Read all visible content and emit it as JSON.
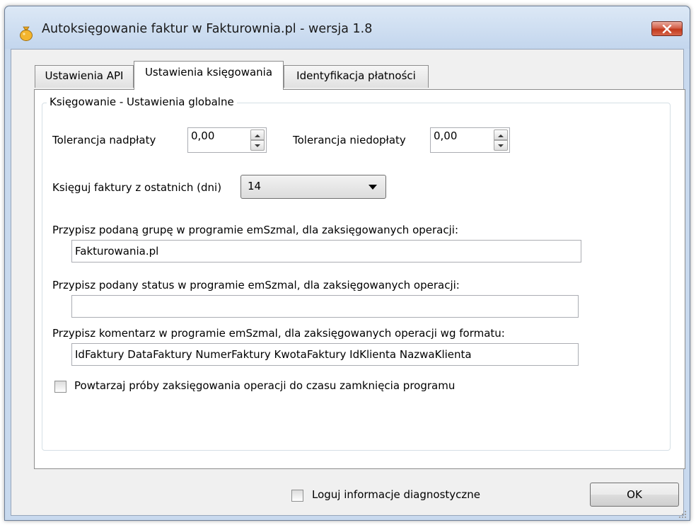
{
  "window": {
    "title": "Autoksięgowanie faktur w Fakturownia.pl - wersja 1.8"
  },
  "tabs": [
    {
      "label": "Ustawienia API",
      "active": false
    },
    {
      "label": "Ustawienia księgowania",
      "active": true
    },
    {
      "label": "Identyfikacja płatności",
      "active": false
    }
  ],
  "group": {
    "legend": "Księgowanie - Ustawienia globalne"
  },
  "overpay": {
    "label": "Tolerancja nadpłaty",
    "value": "0,00"
  },
  "underpay": {
    "label": "Tolerancja niedopłaty",
    "value": "0,00"
  },
  "days": {
    "label": "Księguj faktury z ostatnich (dni)",
    "value": "14"
  },
  "group_assign": {
    "label": "Przypisz podaną grupę w programie emSzmal, dla zaksięgowanych operacji:",
    "value": "Fakturowania.pl"
  },
  "status_assign": {
    "label": "Przypisz podany status w programie emSzmal, dla zaksięgowanych operacji:",
    "value": ""
  },
  "comment_assign": {
    "label": "Przypisz komentarz w programie emSzmal, dla zaksięgowanych operacji wg formatu:",
    "value": "IdFaktury DataFaktury NumerFaktury KwotaFaktury IdKlienta NazwaKlienta"
  },
  "retry": {
    "label": "Powtarzaj próby zaksięgowania operacji do czasu zamknięcia programu",
    "checked": false
  },
  "diagnostics": {
    "label": "Loguj informacje diagnostyczne",
    "checked": false
  },
  "buttons": {
    "ok": "OK"
  },
  "colors": {
    "title_bar": "#c3d6ed",
    "close_button": "#c9452a",
    "client_background": "#f0f0f0",
    "panel_background": "#ffffff"
  },
  "icons": {
    "app": "money-bag-icon",
    "close": "close-icon",
    "resize": "resize-grip-icon"
  }
}
